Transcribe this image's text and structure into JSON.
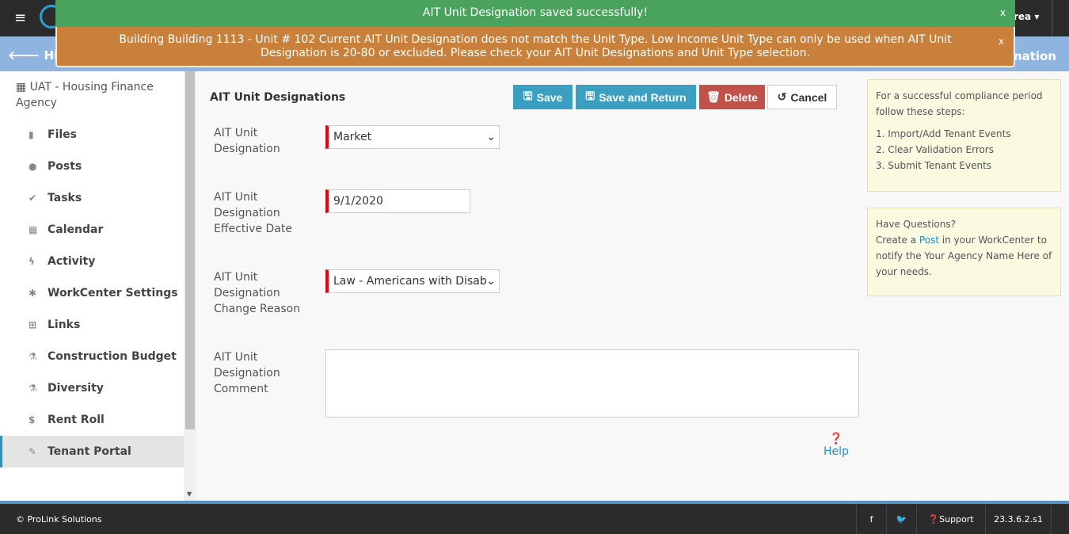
{
  "nav": {
    "account_label": "rea",
    "back_label": "Hilltop",
    "page_crumb": "gnation"
  },
  "alerts": {
    "success": "AIT Unit Designation saved successfully!",
    "warning": "Building Building 1113 - Unit # 102 Current AIT Unit Designation does not match the Unit Type. Low Income Unit Type can only be used when AIT Unit Designation is 20-80 or excluded. Please check your AIT Unit Designations and Unit Type selection.",
    "close": "x"
  },
  "sidebar": {
    "agency": "UAT - Housing Finance Agency",
    "items": [
      {
        "label": "Files",
        "icon": "file-icon",
        "glyph": "▮"
      },
      {
        "label": "Posts",
        "icon": "comments-icon",
        "glyph": "●"
      },
      {
        "label": "Tasks",
        "icon": "check-icon",
        "glyph": "✔"
      },
      {
        "label": "Calendar",
        "icon": "calendar-icon",
        "glyph": "▦"
      },
      {
        "label": "Activity",
        "icon": "bolt-icon",
        "glyph": "ϟ"
      },
      {
        "label": "WorkCenter Settings",
        "icon": "gear-icon",
        "glyph": "✱"
      },
      {
        "label": "Links",
        "icon": "sitemap-icon",
        "glyph": "⊞"
      },
      {
        "label": "Construction Budget",
        "icon": "flask-icon",
        "glyph": "⚗"
      },
      {
        "label": "Diversity",
        "icon": "flask-icon",
        "glyph": "⚗"
      },
      {
        "label": "Rent Roll",
        "icon": "dollar-icon",
        "glyph": "$"
      },
      {
        "label": "Tenant Portal",
        "icon": "pencil-icon",
        "glyph": "✎"
      }
    ]
  },
  "form": {
    "title": "AIT Unit Designations",
    "buttons": {
      "save": "Save",
      "save_return": "Save and Return",
      "delete": "Delete",
      "cancel": "Cancel"
    },
    "designation_label": "AIT Unit Designation",
    "designation_value": "Market",
    "date_label": "AIT Unit Designation Effective Date",
    "date_value": "9/1/2020",
    "reason_label": "AIT Unit Designation Change Reason",
    "reason_value": "Law - Americans with Disabilitie",
    "comment_label": "AIT Unit Designation Comment",
    "comment_value": "",
    "help": "Help"
  },
  "notes": {
    "steps_intro": "For a successful compliance period follow these steps:",
    "steps": [
      "1. Import/Add Tenant Events",
      "2. Clear Validation Errors",
      "3. Submit Tenant Events"
    ],
    "q_title": "Have Questions?",
    "q_pre": "Create a ",
    "q_link": "Post",
    "q_post": " in your WorkCenter to notify the Your Agency Name Here of your needs."
  },
  "footer": {
    "copyright": "© ProLink Solutions",
    "support": "Support",
    "version": "23.3.6.2.s1"
  },
  "colors": {
    "primary": "#3a9fc0",
    "danger": "#c0524a",
    "success_alert": "#4aa35c",
    "warning_alert": "#c8803a"
  }
}
